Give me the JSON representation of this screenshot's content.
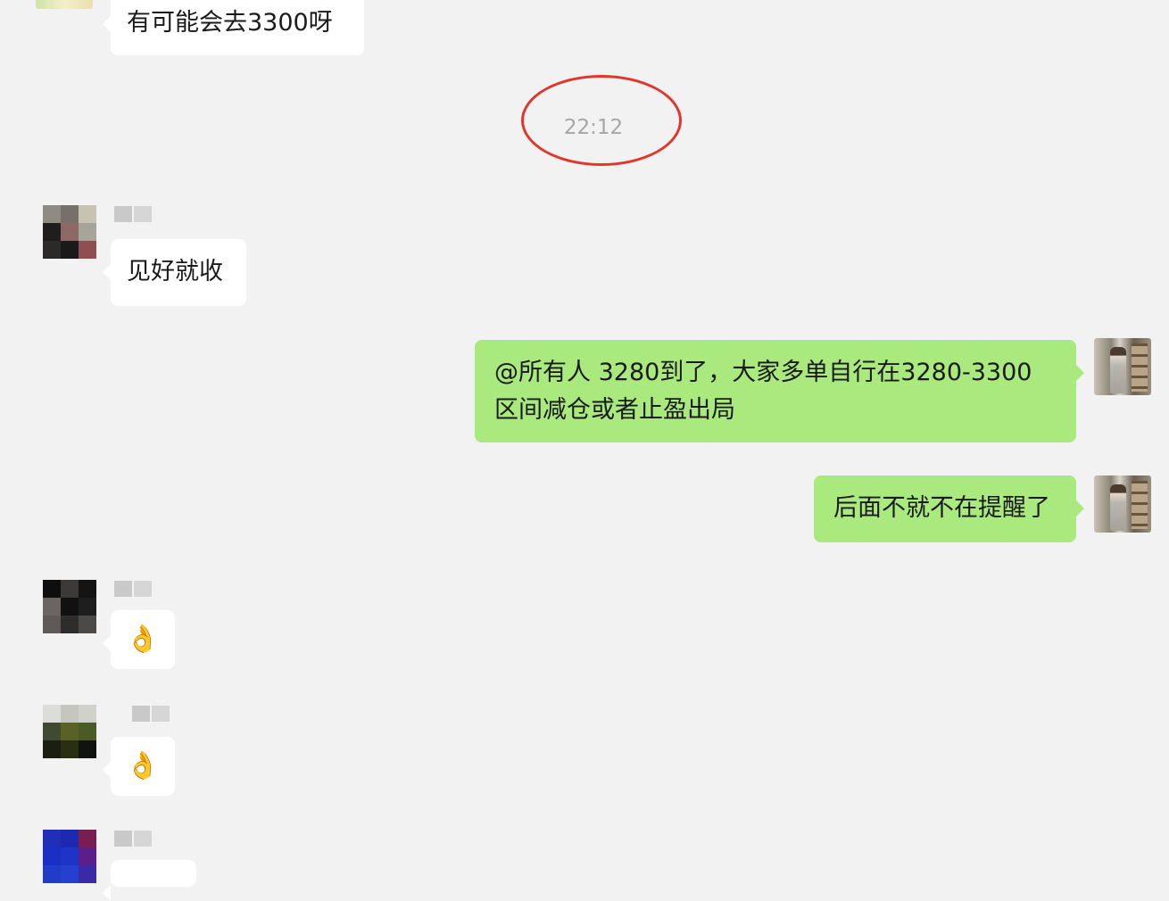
{
  "messages": [
    {
      "id": "m1",
      "side": "in",
      "text": "有可能会去3300呀"
    },
    {
      "id": "m2",
      "side": "in",
      "text": "见好就收"
    },
    {
      "id": "m3",
      "side": "out",
      "lines": [
        "@所有人 3280到了，大家多单自行在3280-3300",
        "区间减仓或者止盈出局"
      ]
    },
    {
      "id": "m4",
      "side": "out",
      "text": "后面不就不在提醒了"
    },
    {
      "id": "m5",
      "side": "in",
      "text": "👌"
    },
    {
      "id": "m6",
      "side": "in",
      "text": "👌"
    }
  ],
  "timestamp": "22:12",
  "annotation_color": "#e0362c",
  "colors": {
    "background": "#f2f2f2",
    "incoming_bubble": "#ffffff",
    "outgoing_bubble": "#a9e97e"
  },
  "icons": {
    "ok_hand": "ok-hand-emoji"
  }
}
